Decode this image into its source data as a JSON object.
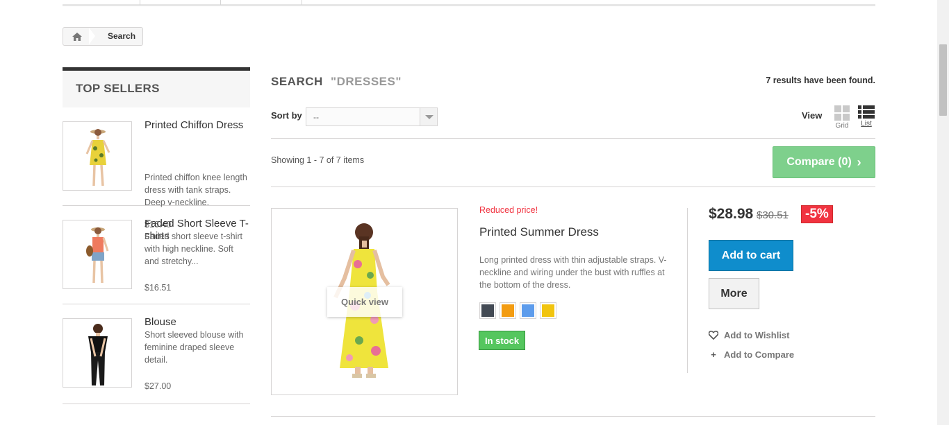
{
  "breadcrumb": {
    "current": "Search"
  },
  "sidebar": {
    "title": "Top sellers",
    "items": [
      {
        "name": "Printed Chiffon Dress",
        "description": "Printed chiffon knee length dress with tank straps. Deep v-neckline.",
        "price": "$16.40"
      },
      {
        "name": "Faded Short Sleeve T-shirts",
        "description": "Faded short sleeve t-shirt with high neckline. Soft and stretchy...",
        "price": "$16.51"
      },
      {
        "name": "Blouse",
        "description": "Short sleeved blouse with feminine draped sleeve detail.",
        "price": "$27.00"
      }
    ]
  },
  "search": {
    "heading": "Search",
    "term": "\"DRESSES\"",
    "result_count": "7 results have been found."
  },
  "toolbar": {
    "sort_label": "Sort by",
    "sort_value": "--",
    "view_label": "View",
    "view_grid": "Grid",
    "view_list": "List",
    "showing": "Showing 1 - 7 of 7 items",
    "compare_label": "Compare (0)"
  },
  "product": {
    "flag": "Reduced price!",
    "name": "Printed Summer Dress",
    "description": "Long printed dress with thin adjustable straps. V-neckline and wiring under the bust with ruffles at the bottom of the dress.",
    "quick_view": "Quick view",
    "stock": "In stock",
    "price": "$28.98",
    "old_price": "$30.51",
    "discount": "-5%",
    "add_to_cart": "Add to cart",
    "more": "More",
    "wishlist": "Add to Wishlist",
    "compare": "Add to Compare",
    "colors": [
      "#434a54",
      "#f39c11",
      "#5d9cec",
      "#f1c40f"
    ]
  },
  "colors": {
    "accent_blue": "#0f8dcc",
    "compare_green": "#7ed08c",
    "sale_red": "#f13340",
    "stock_green": "#55c65e"
  },
  "icons": {
    "home": "home-icon",
    "heart": "heart-icon",
    "plus": "plus-icon",
    "grid": "grid-view-icon",
    "list": "list-view-icon"
  }
}
